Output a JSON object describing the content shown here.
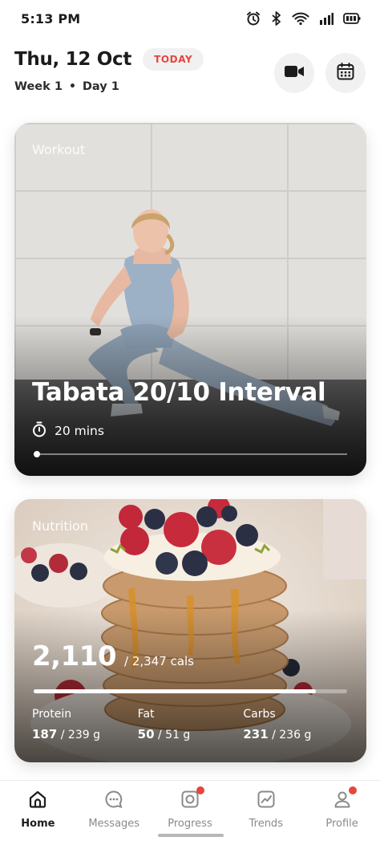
{
  "status_bar": {
    "time": "5:13 PM",
    "icons": [
      "alarm-icon",
      "bluetooth-icon",
      "wifi-icon",
      "signal-icon",
      "battery-icon"
    ]
  },
  "header": {
    "date": "Thu, 12 Oct",
    "today_badge": "TODAY",
    "week": "Week 1",
    "separator": "•",
    "day": "Day 1",
    "buttons": [
      "video-camera-icon",
      "calendar-icon"
    ],
    "accent_color": "#e5463c"
  },
  "workout": {
    "label": "Workout",
    "title": "Tabata 20/10 Interval",
    "duration": "20 mins",
    "progress": 0.01,
    "image": "woman-stretching-photo"
  },
  "nutrition": {
    "label": "Nutrition",
    "calories_consumed": "2,110",
    "calories_goal": "/ 2,347 cals",
    "progress": 0.9,
    "image": "pancake-stack-photo",
    "macros": [
      {
        "label": "Protein",
        "value": "187",
        "goal": " / 239 g"
      },
      {
        "label": "Fat",
        "value": "50",
        "goal": " / 51 g"
      },
      {
        "label": "Carbs",
        "value": "231",
        "goal": " / 236 g"
      }
    ]
  },
  "bottom_nav": {
    "items": [
      {
        "label": "Home",
        "icon": "home-icon",
        "active": true,
        "badge": false
      },
      {
        "label": "Messages",
        "icon": "message-icon",
        "active": false,
        "badge": false
      },
      {
        "label": "Progress",
        "icon": "progress-icon",
        "active": false,
        "badge": true
      },
      {
        "label": "Trends",
        "icon": "trends-icon",
        "active": false,
        "badge": false
      },
      {
        "label": "Profile",
        "icon": "profile-icon",
        "active": false,
        "badge": true
      }
    ]
  }
}
